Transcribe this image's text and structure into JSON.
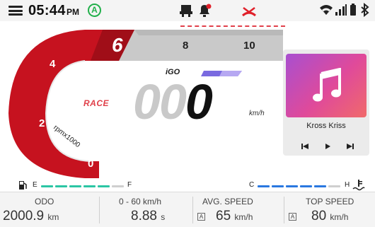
{
  "status_bar": {
    "time": "05:44",
    "ampm": "PM",
    "drive_mode_badge": "A",
    "icons": [
      "menu-icon",
      "phone-battery-icon",
      "notification-bell-icon",
      "missed-call-icon",
      "wifi-icon",
      "signal-icon",
      "battery-icon",
      "bluetooth-icon"
    ],
    "alert_color": "#e0202a"
  },
  "tachometer": {
    "tick_labels": [
      "0",
      "2",
      "4",
      "6",
      "8",
      "10"
    ],
    "unit_label": "rpmx1000",
    "mode": "RACE",
    "brand": "iGO",
    "red_color": "#c6121f",
    "grey_color": "#c9c9c9"
  },
  "speed": {
    "value": "000",
    "unit": "km/h"
  },
  "media": {
    "track": "Kross Kriss",
    "icons": [
      "music-note-icon",
      "previous-icon",
      "play-icon",
      "next-icon"
    ]
  },
  "gauges": {
    "fuel": {
      "empty_label": "E",
      "full_label": "F",
      "level": 0.75,
      "color": "#2bc6a4"
    },
    "temp": {
      "cold_label": "C",
      "hot_label": "H",
      "level": 0.75,
      "color": "#2a78e0"
    }
  },
  "stats": [
    {
      "label": "ODO",
      "value": "2000.9",
      "unit": "km"
    },
    {
      "label": "0 - 60 km/h",
      "value": "8.88",
      "unit": "s"
    },
    {
      "label": "AVG. SPEED",
      "value": "65",
      "unit": "km/h",
      "badge": "A"
    },
    {
      "label": "TOP SPEED",
      "value": "80",
      "unit": "km/h",
      "badge": "A"
    }
  ]
}
